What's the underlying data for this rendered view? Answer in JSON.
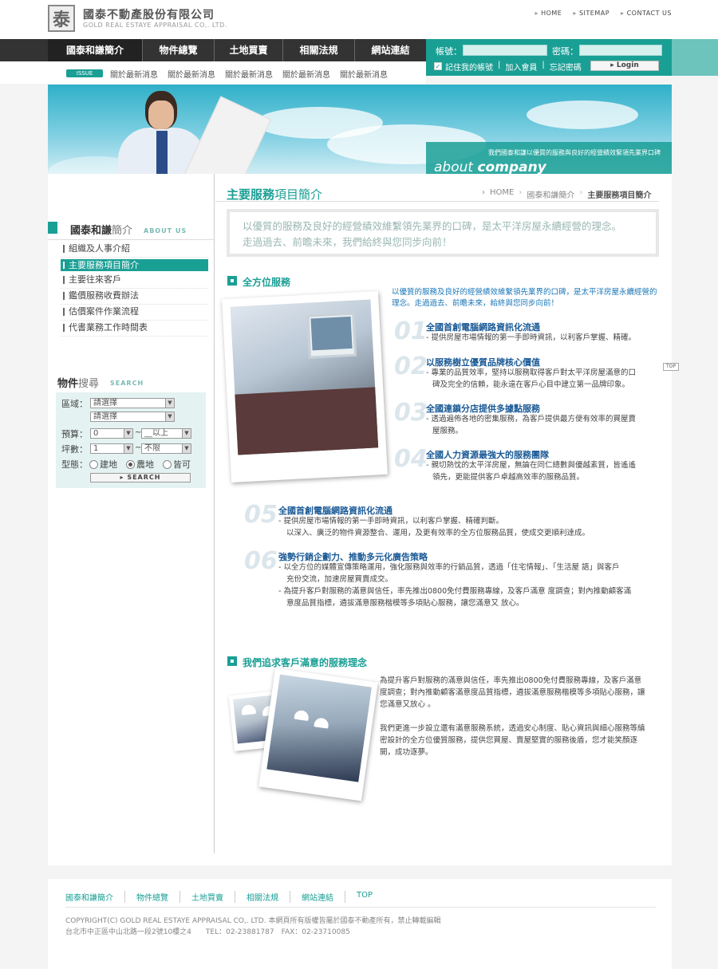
{
  "header": {
    "logo_char": "泰",
    "company_cn": "國泰不動產股份有限公司",
    "company_en": "GOLD REAL ESTAYE APPRAISAL CO,. LTD.",
    "top_links": [
      "HOME",
      "SITEMAP",
      "CONTACT US"
    ]
  },
  "nav": {
    "items": [
      "國泰和謙簡介",
      "物件總覽",
      "土地買賣",
      "相關法規",
      "網站連結"
    ]
  },
  "issue": {
    "badge": "ISSUE",
    "news": [
      "關於最新消息",
      "關於最新消息",
      "關於最新消息",
      "關於最新消息",
      "關於最新消息"
    ]
  },
  "login": {
    "account_label": "帳號：",
    "password_label": "密碼：",
    "remember_label": "記住我的帳號",
    "join_label": "加入會員",
    "forgot_label": "忘記密碼",
    "login_button": "Login"
  },
  "banner": {
    "slogan": "我們國泰和謙以優質的服務與良好的經營績效緊領先業界口碑",
    "about_1": "about",
    "about_2": "company"
  },
  "sidebar": {
    "heading_main": "國泰和謙",
    "heading_light": "簡介",
    "heading_en": "ABOUT US",
    "menu": [
      {
        "label": "組織及人事介紹"
      },
      {
        "label": "主要服務項目簡介"
      },
      {
        "label": "主要往來客戶"
      },
      {
        "label": "鑑價服務收費辦法"
      },
      {
        "label": "估價案件作業流程"
      },
      {
        "label": "代書業務工作時間表"
      }
    ],
    "search": {
      "heading_main": "物件",
      "heading_light": "搜尋",
      "heading_en": "SEARCH",
      "area_label": "區域：",
      "area_1": "請選擇",
      "area_2": "請選擇",
      "budget_label": "預算：",
      "budget_from": "0",
      "budget_to": "__以上",
      "size_label": "坪數：",
      "size_from": "1",
      "size_to": "不限",
      "type_label": "型態：",
      "type_options": [
        "建地",
        "農地",
        "皆可"
      ],
      "type_selected": "農地",
      "tilde": "~",
      "button": "SEARCH"
    }
  },
  "main": {
    "title_main": "主要服務",
    "title_light": "項目簡介",
    "breadcrumb": [
      "HOME",
      "國泰和謙簡介",
      "主要服務項目簡介"
    ],
    "breadcrumb_sep": "›",
    "intro_1": "以優質的服務及良好的經營績效維繫領先業界的口碑，是太平洋房屋永續經營的理念。",
    "intro_2": "走過過去、前瞻未來，我們給終與您同步向前！",
    "section1_title": "全方位服務",
    "lead": "以優質的服務及良好的經營績效維繫領先業界的口碑，是太平洋房屋永續經營的理念。走過過去、前瞻未來，給終與您同步向前！",
    "items": [
      {
        "num": "01",
        "title": "全國首創電腦網路資訊化流通",
        "lines": [
          "- 提供房屋市場情報的第一手即時資訊，以利客戶掌握、精確。"
        ]
      },
      {
        "num": "02",
        "title": "以服務樹立優質品牌核心價值",
        "lines": [
          "- 專業的品質效率，堅持以服務取得客戶對太平洋房屋滿意的口",
          "碑及完全的信賴，能永遠在客戶心目中建立第一品牌印象。"
        ]
      },
      {
        "num": "03",
        "title": "全國連鎖分店提供多據點服務",
        "lines": [
          "- 透過遍佈各地的密集服務，為客戶提供最方便有效率的買屋賣",
          "屋服務。"
        ]
      },
      {
        "num": "04",
        "title": "全國人力資源最強大的服務團隊",
        "lines": [
          "- 親切熱忱的太平洋房屋，無論在同仁總數與優越素質，皆遙遙",
          "領先，更能提供客戶卓越高效率的服務品質。"
        ]
      },
      {
        "num": "05",
        "title": "全國首創電腦網路資訊化流通",
        "lines": [
          "- 提供房屋市場情報的第一手即時資訊，以利客戶掌握、精確判斷。",
          "以深入、廣泛的物件資源整合、運用，及更有效率的全方位服務品質，使成交更順利達成。"
        ]
      },
      {
        "num": "06",
        "title": "強勢行銷企劃力、推動多元化廣告策略",
        "lines": [
          "- 以全方位的媒體宣傳策略運用，強化服務與效率的行銷品質，透過「住宅情報」、「生活屋 語」與客戶",
          "充份交流，加速房屋買賣成交。",
          "- 為提升客戶對服務的滿意與信任，率先推出0800免付費服務專線，及客戶滿意 度調查；對內推動顧客滿",
          "意度品質指標，遴拔滿意服務楷模等多項貼心服務，讓您滿意又 放心。"
        ]
      }
    ],
    "top_button": "TOP",
    "section2_title": "我們追求客戶滿意的服務理念",
    "svc_p1": "為提升客戶對服務的滿意與信任，率先推出0800免付費服務專線，及客戶滿意 度調查；對內推動顧客滿意度品質指標，遴拔滿意服務楷模等多項貼心服務，讓您滿意又放心 。",
    "svc_p2": "我們更進一步設立還有滿意服務系統，透過安心制度、貼心資訊與細心服務等縝密設計的全方位優質服務，提供您買屋、賣屋堅實的服務後盾，您才能笑顏逐開，成功逐夢。"
  },
  "footer": {
    "links": [
      "國泰和謙簡介",
      "物件總覽",
      "土地買賣",
      "相關法規",
      "網站連結",
      "TOP"
    ],
    "copyright": "COPYRIGHT(C) GOLD REAL ESTAYE APPRAISAL CO,. LTD. 本網頁所有版權皆屬於國泰不動產所有，禁止轉載編輯",
    "address": "台北市中正區中山北路一段2號10樓之4　　TEL：02-23881787　FAX：02-23710085"
  },
  "colors": {
    "accent": "#1a9f95",
    "nav": "#333333",
    "link_blue": "#1a5a96"
  }
}
